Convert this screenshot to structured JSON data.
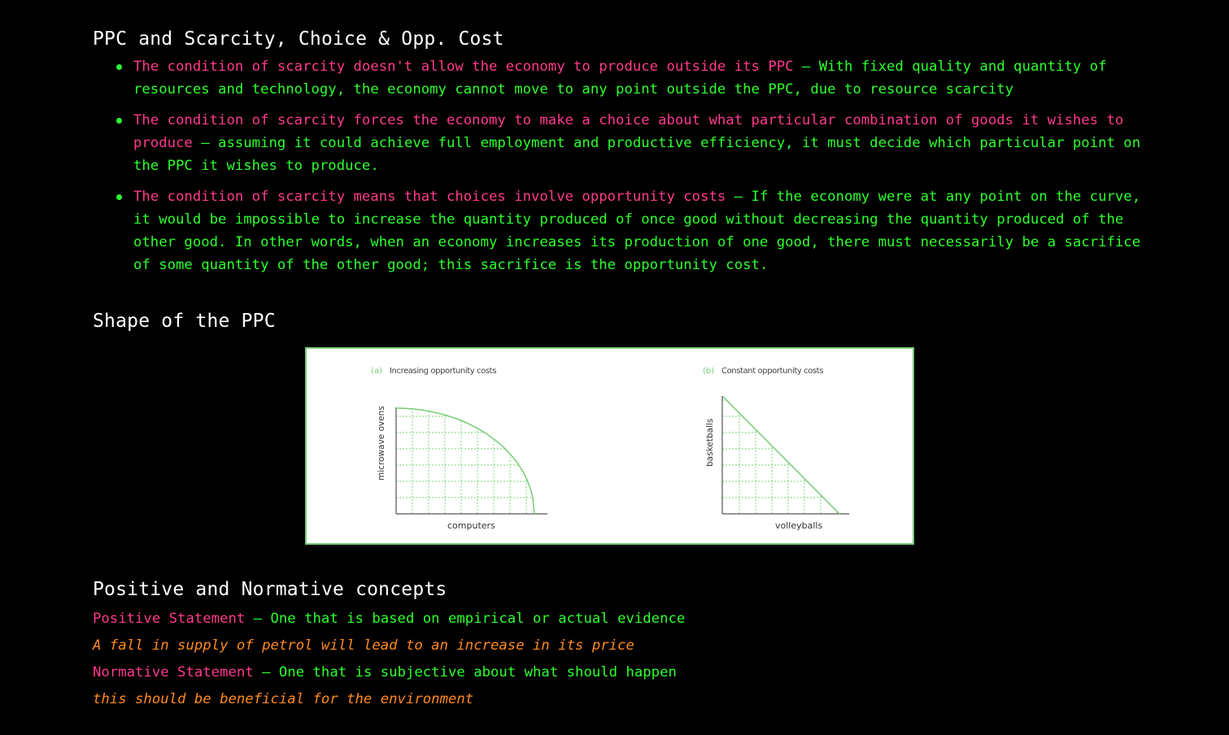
{
  "sections": {
    "scarcity": {
      "title": "PPC and Scarcity, Choice & Opp. Cost",
      "bullets": [
        {
          "lead": "The condition of scarcity doesn't allow the economy to produce outside its PPC",
          "rest": " – With fixed quality and quantity of resources and technology, the economy cannot move to any point outside the PPC, due to resource scarcity"
        },
        {
          "lead": "The condition of scarcity forces the economy to make a choice about what particular combination of goods it wishes to produce",
          "rest": " – assuming it could achieve full employment and productive efficiency, it must decide which particular point on the PPC it wishes to produce."
        },
        {
          "lead": "The condition of scarcity means that choices involve opportunity costs",
          "rest": " – If the economy were at any point on the curve, it would be impossible to increase the quantity produced of once good without decreasing the quantity produced of the other good. In other words, when an economy increases its production of one good, there must necessarily be a  sacrifice of some quantity of the other good; this sacrifice is the opportunity cost."
        }
      ]
    },
    "shape": {
      "title": "Shape of the PPC",
      "figure": {
        "panel_a": {
          "letter": "(a)",
          "title": "Increasing opportunity costs",
          "ylabel": "microwave ovens",
          "xlabel": "computers",
          "curve": "concave"
        },
        "panel_b": {
          "letter": "(b)",
          "title": "Constant opportunity costs",
          "ylabel": "basketballs",
          "xlabel": "volleyballs",
          "curve": "straight line"
        },
        "line_color": "#7ccf7c"
      }
    },
    "normative": {
      "title": "Positive and Normative concepts",
      "positive_label": "Positive Statement",
      "positive_def": " – One that is based on empirical or actual evidence",
      "positive_example": "A fall in supply of petrol will lead to an increase in its price",
      "normative_label": "Normative Statement",
      "normative_def": " – One that is subjective about what should happen",
      "normative_example": "this should be beneficial for the environment"
    }
  },
  "colors": {
    "background": "#000000",
    "heading": "#ffffff",
    "highlight": "#ff3a8c",
    "body": "#2dff2d",
    "example": "#ff8a1e"
  }
}
